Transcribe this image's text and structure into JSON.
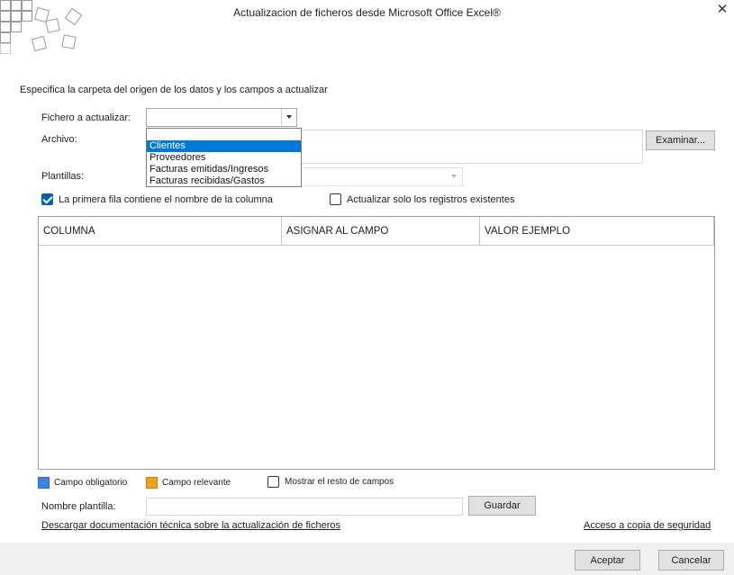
{
  "window": {
    "title": "Actualizacion de ficheros desde Microsoft Office Excel®",
    "close_glyph": "✕"
  },
  "instructions": "Especifica la carpeta del origen de los datos y los campos a actualizar",
  "fichero": {
    "label": "Fichero a actualizar:",
    "value": "",
    "options": [
      "Clientes",
      "Proveedores",
      "Facturas emitidas/Ingresos",
      "Facturas recibidas/Gastos"
    ],
    "selected_index": 0
  },
  "archivo": {
    "label": "Archivo:",
    "value": "",
    "button": "Examinar..."
  },
  "plantillas": {
    "label": "Plantillas:",
    "value": ""
  },
  "options": {
    "primera_fila": {
      "label": "La primera fila contiene el nombre de la columna",
      "checked": true
    },
    "solo_existentes": {
      "label": "Actualizar solo los registros existentes",
      "checked": false
    }
  },
  "grid": {
    "columns": [
      "COLUMNA",
      "ASIGNAR AL CAMPO",
      "VALOR EJEMPLO"
    ],
    "rows": []
  },
  "legend": {
    "obligatorio": {
      "label": "Campo obligatorio",
      "color": "#3c82e6"
    },
    "relevante": {
      "label": "Campo relevante",
      "color": "#f0a01e"
    },
    "mostrar_resto": {
      "label": "Mostrar el resto de campos",
      "checked": false
    }
  },
  "nombre_plantilla": {
    "label": "Nombre plantilla:",
    "value": "",
    "button": "Guardar"
  },
  "links": {
    "documentacion": "Descargar documentación técnica sobre la actualización de ficheros",
    "copia": "Acceso a copia de seguridad"
  },
  "footer": {
    "aceptar": "Aceptar",
    "cancelar": "Cancelar"
  }
}
